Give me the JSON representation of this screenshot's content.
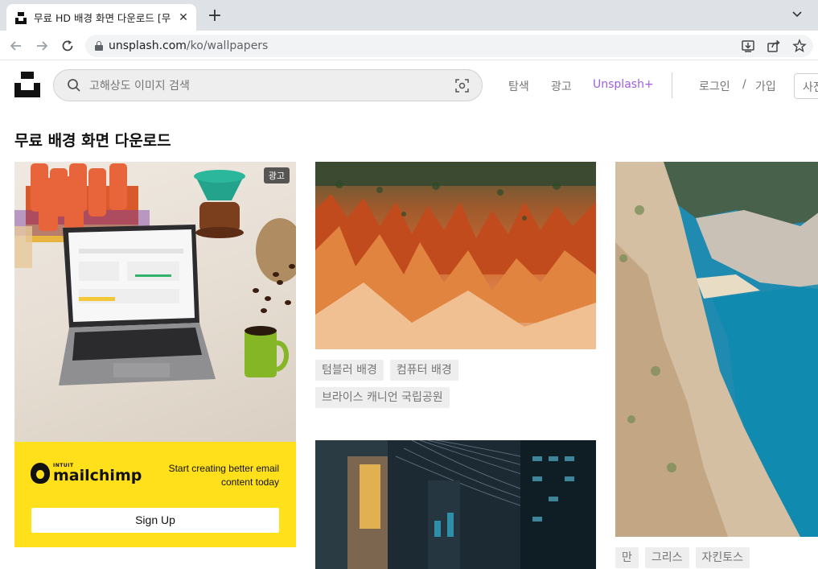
{
  "browser": {
    "tab_title": "무료 HD 배경 화면 다운로드 [무",
    "url_host": "unsplash.com",
    "url_path": "/ko/wallpapers"
  },
  "header": {
    "search_placeholder": "고해상도 이미지 검색",
    "nav": {
      "explore": "탐색",
      "advertise": "광고",
      "plus": "Unsplash+",
      "login": "로그인",
      "sep": "/",
      "join": "가입",
      "submit": "사진 제출"
    }
  },
  "page": {
    "title": "무료 배경 화면 다운로드"
  },
  "ad": {
    "badge": "광고",
    "brand_small": "INTUIT",
    "brand": "mailchimp",
    "copy": "Start creating better email content today",
    "cta": "Sign Up"
  },
  "canyon_tags": [
    "텀블러 배경",
    "컴퓨터 배경",
    "브라이스 캐니언 국립공원"
  ],
  "beach_tags": [
    "만",
    "그리스",
    "자킨토스"
  ],
  "colors": {
    "accent_plus": "#9f5fe0",
    "ad_yellow": "#ffe01b"
  }
}
